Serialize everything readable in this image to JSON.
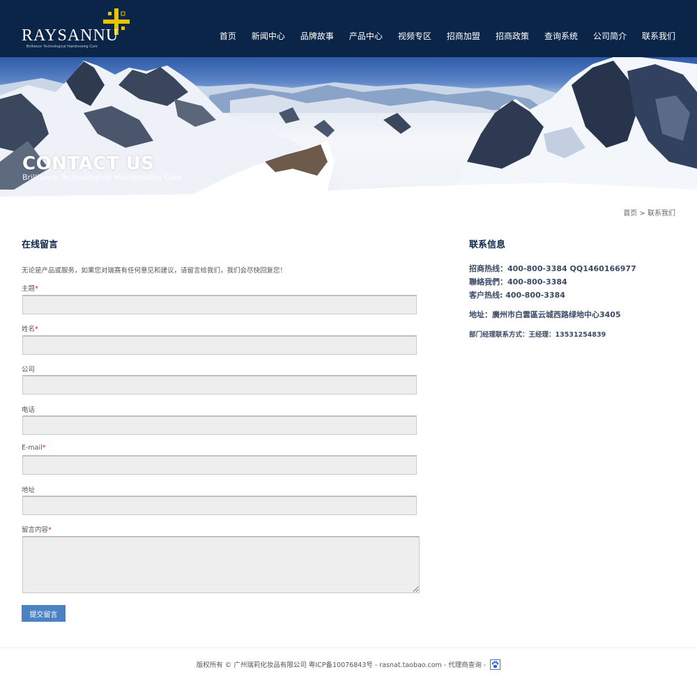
{
  "brand": {
    "name": "RAYSANNU",
    "tagline": "Brilliance Technological Hairdressing Cure",
    "accent": "#e8c300"
  },
  "nav": {
    "items": [
      "首页",
      "新闻中心",
      "品牌故事",
      "产品中心",
      "视频专区",
      "招商加盟",
      "招商政策",
      "查询系统",
      "公司简介",
      "联系我们"
    ]
  },
  "banner": {
    "title": "CONTACT US",
    "subtitle": "Brilliance Technological Hairdressing Cure"
  },
  "breadcrumb": {
    "home": "首页",
    "separator": " > ",
    "current": "联系我们"
  },
  "form": {
    "title": "在线留言",
    "intro": "无论是产品或服务，如果您对瑞赛有任何意见和建议，请留言给我们，我们会尽快回复您！",
    "required_mark": "*",
    "fields": {
      "subject": {
        "label": "主题",
        "value": ""
      },
      "name": {
        "label": "姓名",
        "value": ""
      },
      "company": {
        "label": "公司",
        "value": ""
      },
      "phone": {
        "label": "电话",
        "value": ""
      },
      "email": {
        "label": "E-mail",
        "value": ""
      },
      "address": {
        "label": "地址",
        "value": ""
      },
      "message": {
        "label": "留言内容",
        "value": ""
      }
    },
    "submit_label": "提交留言"
  },
  "contact": {
    "title": "联系信息",
    "lines": [
      "招商热线：400-800-3384 QQ1460166977",
      "聯絡我們：400-800-3384",
      "客户热线: 400-800-3384",
      "地址：廣州市白雲區云城西路绿地中心3405",
      "部门经理联系方式：王经理：13531254839"
    ]
  },
  "footer": {
    "text": "版权所有 © 广州瑞莉化妆品有限公司 粤ICP备10076843号 - rasnat.taobao.com - 代理商查询 -",
    "icon": "baidu-paw-icon"
  },
  "colors": {
    "header_bg": "#0b2548",
    "button": "#4a82c3",
    "required": "#e02020"
  }
}
